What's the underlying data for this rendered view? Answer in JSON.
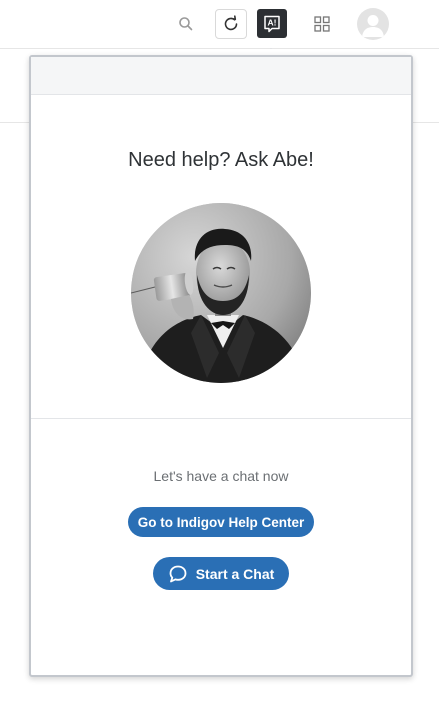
{
  "toolbar": {
    "icons": [
      "search-icon",
      "refresh-icon",
      "ask-abe-icon",
      "apps-grid-icon",
      "user-avatar-icon"
    ],
    "abe_badge": "A!"
  },
  "popover": {
    "title": "Need help? Ask Abe!",
    "image": "abraham-lincoln-tin-can-phone-portrait",
    "subtitle": "Let's have a chat now",
    "help_button": "Go to Indigov Help Center",
    "chat_button": "Start a Chat",
    "chat_icon": "speech-bubble-icon"
  },
  "colors": {
    "primary": "#2a6fb5",
    "toolbar_dark": "#2c2f33",
    "border": "#c3c7cd"
  }
}
